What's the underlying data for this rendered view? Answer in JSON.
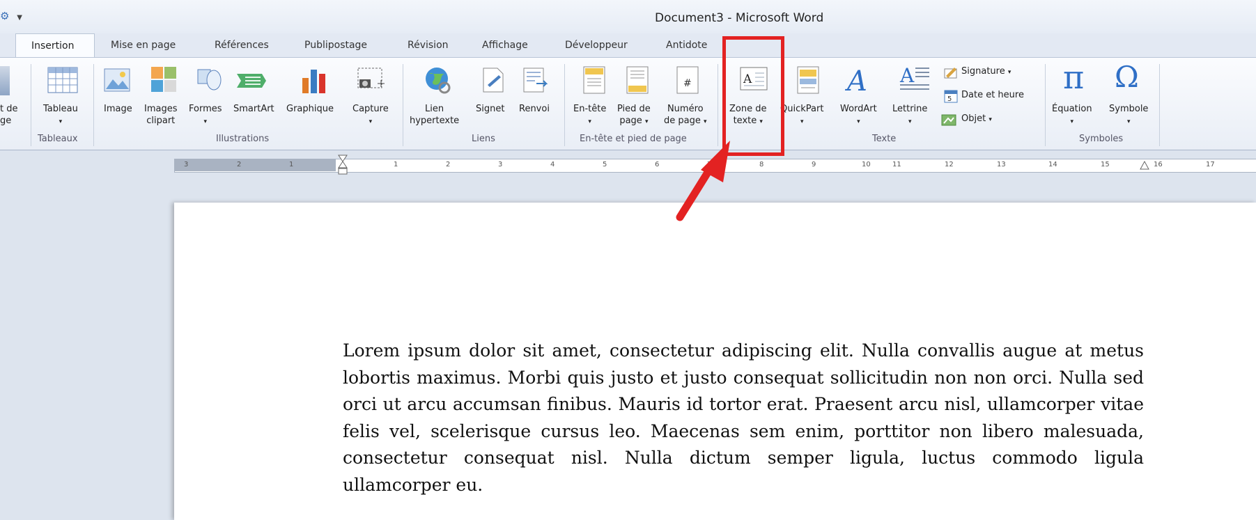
{
  "window": {
    "title": "Document3 - Microsoft Word",
    "quick_access": "▼"
  },
  "tabs": [
    "Insertion",
    "Mise en page",
    "Références",
    "Publipostage",
    "Révision",
    "Affichage",
    "Développeur",
    "Antidote"
  ],
  "ribbon": {
    "buttons": {
      "page_de_garde_1": "t de",
      "page_de_garde_2": "ge",
      "tableau": "Tableau",
      "image": "Image",
      "images_clipart_1": "Images",
      "images_clipart_2": "clipart",
      "formes": "Formes",
      "smartart": "SmartArt",
      "graphique": "Graphique",
      "capture": "Capture",
      "lien_1": "Lien",
      "lien_2": "hypertexte",
      "signet": "Signet",
      "renvoi": "Renvoi",
      "entete": "En-tête",
      "pied_1": "Pied de",
      "pied_2": "page",
      "numero_1": "Numéro",
      "numero_2": "de page",
      "zone_1": "Zone de",
      "zone_2": "texte",
      "quickpart": "QuickPart",
      "wordart": "WordArt",
      "lettrine": "Lettrine",
      "signature": "Signature",
      "date_heure": "Date et heure",
      "objet": "Objet",
      "equation": "Équation",
      "symbole": "Symbole"
    },
    "groups": {
      "tableaux": "Tableaux",
      "illustrations": "Illustrations",
      "liens": "Liens",
      "entete_pied": "En-tête et pied de page",
      "texte": "Texte",
      "symboles": "Symboles"
    }
  },
  "ruler": [
    "3",
    "2",
    "1",
    "1",
    "2",
    "3",
    "4",
    "5",
    "6",
    "7",
    "8",
    "9",
    "10",
    "11",
    "12",
    "13",
    "14",
    "15",
    "16",
    "17"
  ],
  "document": {
    "paragraph": "Lorem ipsum dolor sit amet, consectetur adipiscing elit. Nulla convallis augue at metus lobortis maximus. Morbi quis justo et justo consequat sollicitudin non non orci. Nulla sed orci ut arcu accumsan finibus. Mauris id tortor erat. Praesent arcu nisl, ullamcorper vitae felis vel, scelerisque cursus leo. Maecenas sem enim, porttitor non libero malesuada, consectetur consequat nisl. Nulla dictum semper ligula, luctus commodo ligula ullamcorper eu."
  },
  "colors": {
    "annotation": "#e32222",
    "ribbon_bg": "#f4f7fb",
    "accent": "#2b579a"
  },
  "icons": [
    "table-icon",
    "image-icon",
    "clipart-icon",
    "shapes-icon",
    "smartart-icon",
    "chart-icon",
    "capture-icon",
    "globe-icon",
    "bookmark-icon",
    "crossref-icon",
    "header-icon",
    "footer-icon",
    "page-number-icon",
    "textbox-icon",
    "quickpart-icon",
    "wordart-icon",
    "dropcap-icon",
    "signature-icon",
    "date-icon",
    "object-icon",
    "pi-icon",
    "omega-icon",
    "arrow-annotation"
  ]
}
